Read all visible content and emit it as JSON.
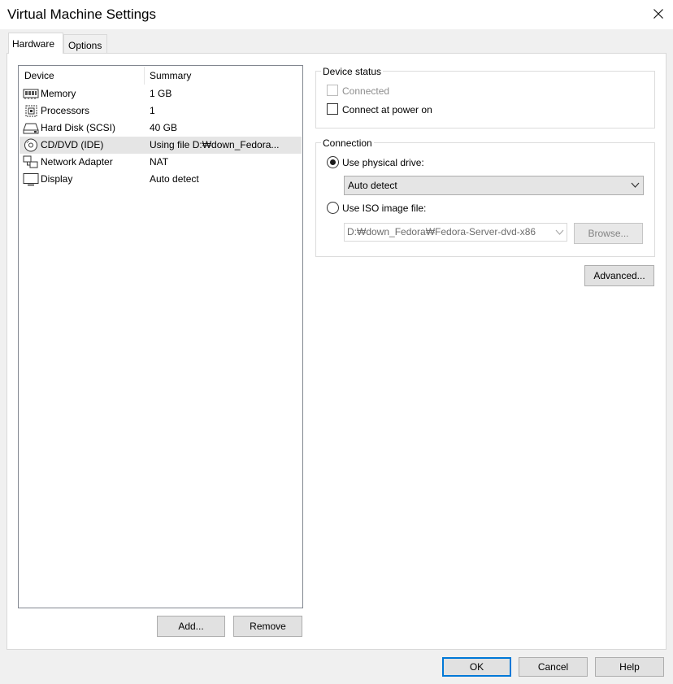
{
  "window": {
    "title": "Virtual Machine Settings"
  },
  "tabs": [
    {
      "label": "Hardware"
    },
    {
      "label": "Options"
    }
  ],
  "device_list": {
    "headers": {
      "device": "Device",
      "summary": "Summary"
    },
    "rows": [
      {
        "name": "Memory",
        "summary": "1 GB",
        "icon": "memory-icon"
      },
      {
        "name": "Processors",
        "summary": "1",
        "icon": "processor-icon"
      },
      {
        "name": "Hard Disk (SCSI)",
        "summary": "40 GB",
        "icon": "hard-disk-icon"
      },
      {
        "name": "CD/DVD (IDE)",
        "summary": "Using file D:₩down_Fedora...",
        "icon": "cd-dvd-icon",
        "selected": true
      },
      {
        "name": "Network Adapter",
        "summary": "NAT",
        "icon": "network-adapter-icon"
      },
      {
        "name": "Display",
        "summary": "Auto detect",
        "icon": "display-icon"
      }
    ]
  },
  "list_buttons": {
    "add": "Add...",
    "remove": "Remove"
  },
  "device_status": {
    "title": "Device status",
    "connected": {
      "label": "Connected",
      "checked": false,
      "disabled": true
    },
    "connect_power_on": {
      "label": "Connect at power on",
      "checked": false
    }
  },
  "connection": {
    "title": "Connection",
    "physical": {
      "label": "Use physical drive:",
      "selected": true
    },
    "drive_select": {
      "value": "Auto detect"
    },
    "iso": {
      "label": "Use ISO image file:",
      "selected": false
    },
    "iso_path": "D:₩down_Fedora₩Fedora-Server-dvd-x86",
    "browse": "Browse..."
  },
  "advanced_button": "Advanced...",
  "footer": {
    "ok": "OK",
    "cancel": "Cancel",
    "help": "Help"
  }
}
